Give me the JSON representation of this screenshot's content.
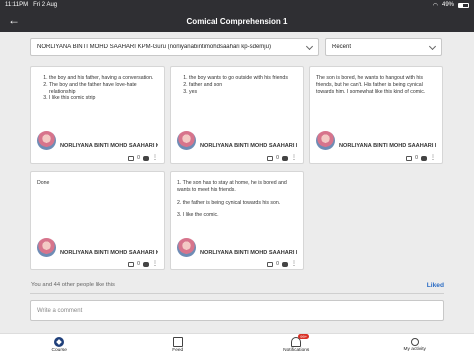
{
  "status": {
    "time": "11:11PM",
    "date": "Fri 2 Aug",
    "battery": "49%"
  },
  "header": {
    "title": "Comical Comprehension 1",
    "back_icon": "back-arrow-icon"
  },
  "filters": {
    "student": "NORLIYANA BINTI MOHD SAAHARI KPM-Guru (norliyanabintimohdsaahari kp-sdemju)",
    "sort": "Recent"
  },
  "cards": [
    {
      "lines": [
        "the boy and his father, having a conversation.",
        "The boy and the father have love-hate relationship",
        "I like this comic strip"
      ],
      "author": "NORLIYANA BINTI MOHD SAAHARI KP...",
      "comments": "0"
    },
    {
      "lines": [
        "the boy wants to go outside with his friends",
        "father and son",
        "yes"
      ],
      "author": "NORLIYANA BINTI MOHD SAAHARI KP...",
      "comments": "0"
    },
    {
      "text": "The son is bored, he wants to hangout with his friends, but he can't. His father is being cynical towards him. I somewhat like this kind of comic.",
      "author": "NORLIYANA BINTI MOHD SAAHARI KP...",
      "comments": "0"
    },
    {
      "text": "Done",
      "author": "NORLIYANA BINTI MOHD SAAHARI KP...",
      "comments": "0"
    },
    {
      "paras": [
        "1. The son has to stay at home, he is bored and wants to meet his friends.",
        "2. the father is being cynical towards his son.",
        "3. I like the comic."
      ],
      "author": "NORLIYANA BINTI MOHD SAAHARI KP...",
      "comments": "0"
    }
  ],
  "likes_text": "You and 44 other people like this",
  "liked_label": "Liked",
  "comment_placeholder": "Write a comment",
  "tabs": [
    {
      "label": "Course",
      "icon": "course-icon"
    },
    {
      "label": "Feed",
      "icon": "feed-icon"
    },
    {
      "label": "Notifications",
      "icon": "bell-icon",
      "badge": "99+"
    },
    {
      "label": "My activity",
      "icon": "user-icon"
    }
  ]
}
